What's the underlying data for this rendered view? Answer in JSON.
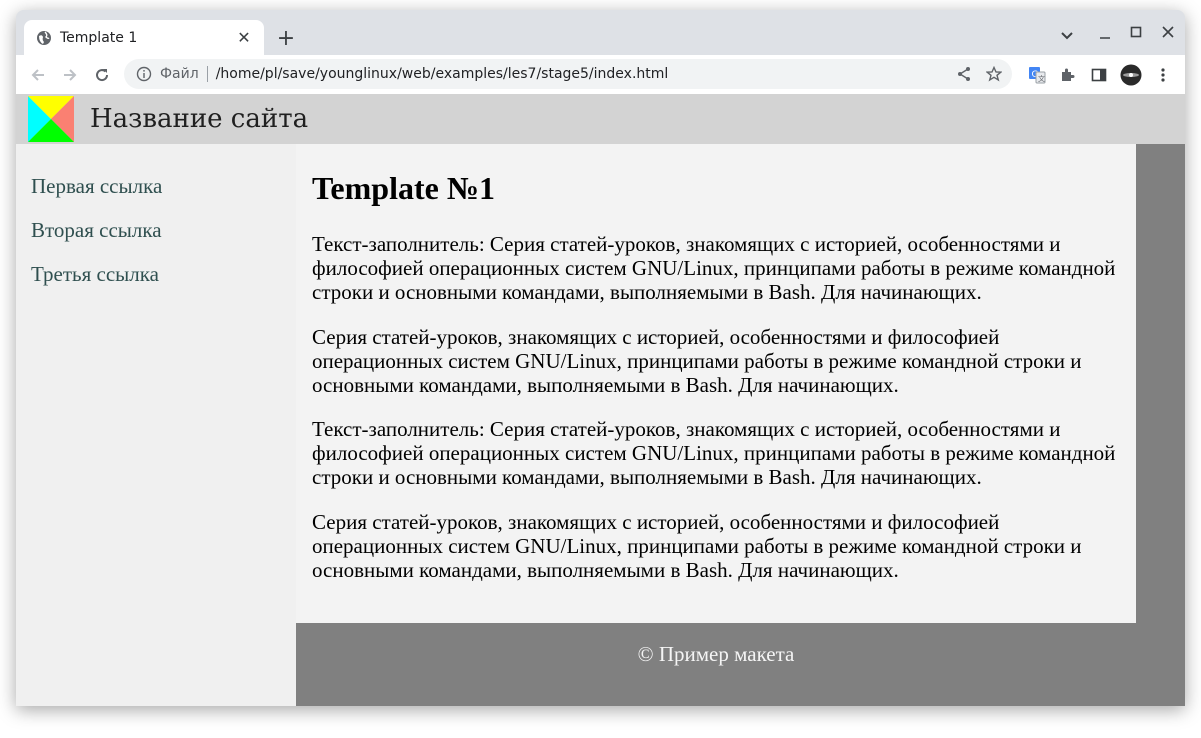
{
  "browser": {
    "tab_title": "Template 1",
    "omnibox_scheme": "Файл",
    "url": "/home/pl/save/younglinux/web/examples/les7/stage5/index.html"
  },
  "site": {
    "title": "Название сайта",
    "nav": [
      "Первая ссылка",
      "Вторая ссылка",
      "Третья ссылка"
    ],
    "heading": "Template №1",
    "paragraphs": [
      "Текст-заполнитель: Серия статей-уроков, знакомящих с историей, особенностями и философией операционных систем GNU/Linux, принципами работы в режиме командной строки и основными командами, выполняемыми в Bash. Для начинающих.",
      "Серия статей-уроков, знакомящих с историей, особенностями и философией операционных систем GNU/Linux, принципами работы в режиме командной строки и основными командами, выполняемыми в Bash. Для начинающих.",
      "Текст-заполнитель: Серия статей-уроков, знакомящих с историей, особенностями и философией операционных систем GNU/Linux, принципами работы в режиме командной строки и основными командами, выполняемыми в Bash. Для начинающих.",
      "Серия статей-уроков, знакомящих с историей, особенностями и философией операционных систем GNU/Linux, принципами работы в режиме командной строки и основными командами, выполняемыми в Bash. Для начинающих."
    ],
    "footer": "© Пример макета"
  },
  "colors": {
    "header_bg": "#d3d3d3",
    "sidebar_bg": "#f0f0f0",
    "main_bg": "#f3f3f3",
    "page_bg": "#808080",
    "link_color": "#2f4f4f"
  },
  "icons": [
    "globe-icon",
    "close-icon",
    "plus-icon",
    "chevron-down-icon",
    "minimize-icon",
    "maximize-icon",
    "window-close-icon",
    "back-arrow-icon",
    "forward-arrow-icon",
    "reload-icon",
    "info-icon",
    "share-icon",
    "star-icon",
    "translate-icon",
    "puzzle-icon",
    "sidepanel-icon",
    "avatar",
    "kebab-menu-icon"
  ]
}
